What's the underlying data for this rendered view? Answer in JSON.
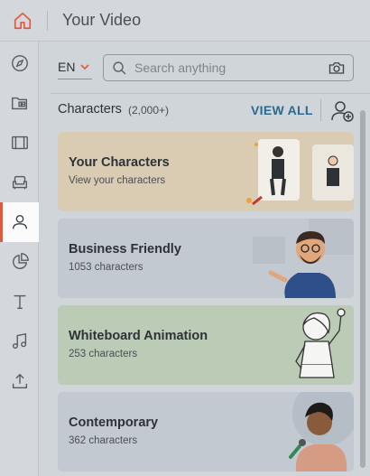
{
  "header": {
    "title": "Your Video"
  },
  "rail": {
    "items": [
      {
        "icon": "compass-icon"
      },
      {
        "icon": "media-folder-icon"
      },
      {
        "icon": "film-icon"
      },
      {
        "icon": "armchair-icon"
      },
      {
        "icon": "person-icon",
        "active": true
      },
      {
        "icon": "pie-chart-icon"
      },
      {
        "icon": "text-icon"
      },
      {
        "icon": "music-icon"
      },
      {
        "icon": "upload-icon"
      }
    ]
  },
  "toolbar": {
    "language": "EN",
    "search_placeholder": "Search anything"
  },
  "section": {
    "title": "Characters",
    "count": "(2,000+)",
    "view_all": "VIEW ALL"
  },
  "cards": [
    {
      "title": "Your Characters",
      "subtitle": "View your characters"
    },
    {
      "title": "Business Friendly",
      "subtitle": "1053 characters"
    },
    {
      "title": "Whiteboard Animation",
      "subtitle": "253 characters"
    },
    {
      "title": "Contemporary",
      "subtitle": "362 characters"
    }
  ],
  "colors": {
    "accent": "#e0593e",
    "link": "#2a6a8e"
  }
}
